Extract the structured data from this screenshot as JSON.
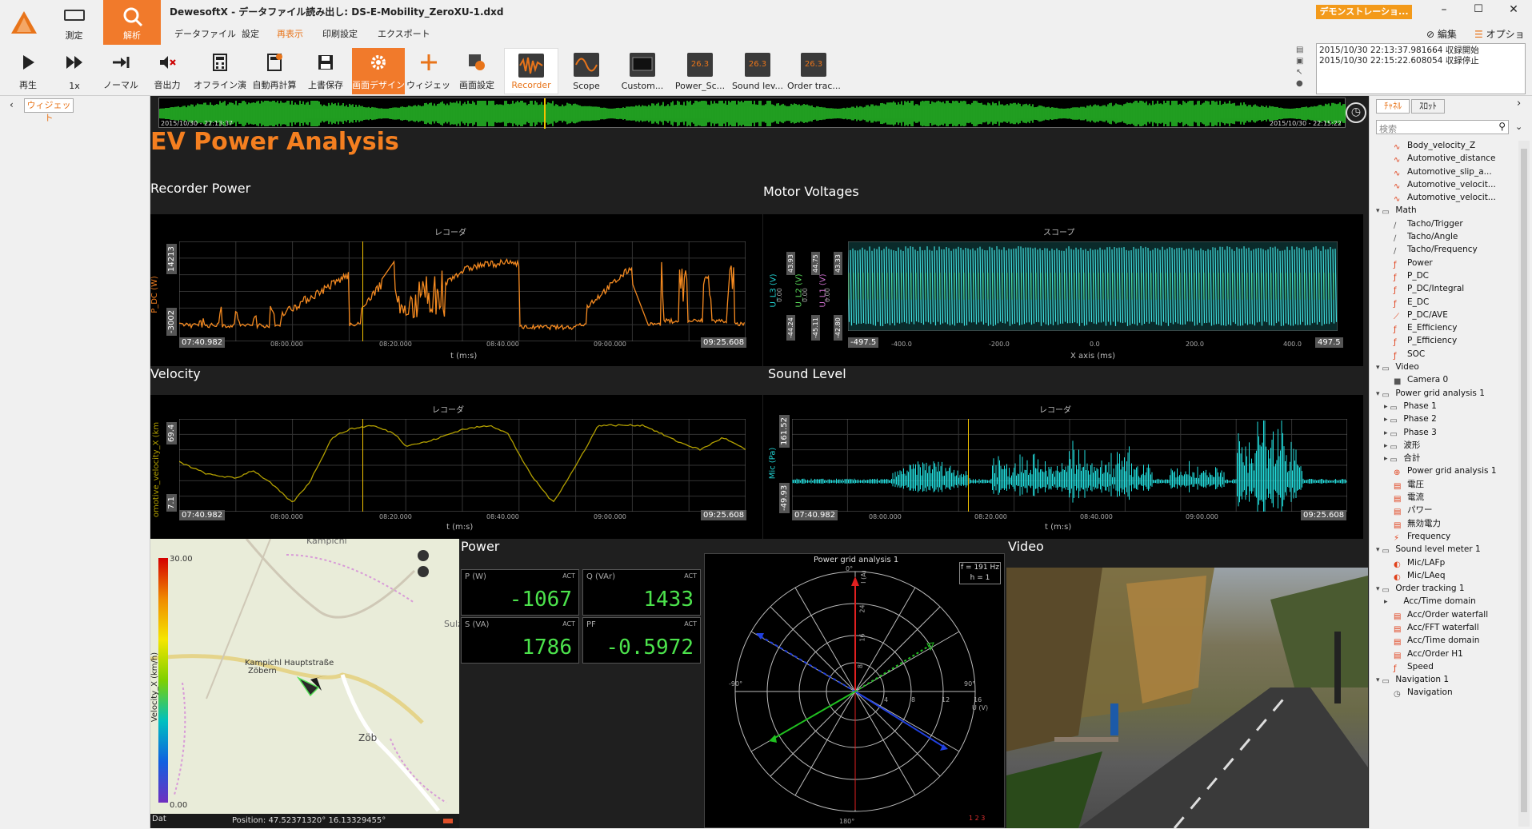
{
  "app": {
    "title": "DewesoftX - データファイル読み出し: DS-E-Mobility_ZeroXU-1.dxd",
    "demo_badge": "デモンストレーショ...",
    "edit_label": "編集",
    "options_label": "オプション"
  },
  "modes": {
    "measure": "測定",
    "analyze": "解析"
  },
  "tabs": [
    "データファイル",
    "設定",
    "再表示",
    "印刷設定",
    "エクスポート"
  ],
  "toolbar": {
    "play": "再生",
    "speed": "1x",
    "normal": "ノーマル",
    "audio": "音出力",
    "offline_calc": "オフライン演算",
    "auto_recalc": "自動再計算",
    "overwrite_save": "上書保存",
    "screen_design": "画面デザイン",
    "widget": "ウィジェット",
    "screen_settings": "画面設定",
    "instruments": [
      "Recorder",
      "Scope",
      "Custom...",
      "Power_Sc...",
      "Sound lev...",
      "Order trac..."
    ],
    "inst_badge": "26.3"
  },
  "log": [
    "2015/10/30 22:13:37.981664 収録開始",
    "2015/10/30 22:15:22.608054 収録停止"
  ],
  "left": {
    "widget_tab": "ウィジェット"
  },
  "overview": {
    "start": "2015/10/30 - 22:13:37",
    "end": "2015/10/30 - 22:15:22"
  },
  "page_title": "EV Power Analysis",
  "recorder_power": {
    "title": "Recorder Power",
    "subtitle": "レコーダ",
    "ylabel": "P_DC (W)",
    "ymax": "14213",
    "ymin": "-3002",
    "xlabel": "t (m:s)",
    "t_start": "07:40.982",
    "t_end": "09:25.608",
    "ticks": [
      "08:00.000",
      "08:20.000",
      "08:40.000",
      "09:00.000"
    ]
  },
  "motor_voltages": {
    "title": "Motor Voltages",
    "subtitle": "スコープ",
    "ylabels": [
      "U_L3 (V)",
      "U_L2 (V)",
      "U_L1 (V)"
    ],
    "axis_max": [
      "43.93",
      "44.75",
      "43.33"
    ],
    "axis_zero": [
      "0.00",
      "0.00",
      "0.00"
    ],
    "axis_min": [
      "-44.24",
      "-45.11",
      "-42.80"
    ],
    "xlabel": "X axis (ms)",
    "x_start": "-497.5",
    "x_end": "497.5",
    "ticks": [
      "-400.0",
      "-200.0",
      "0.0",
      "200.0",
      "400.0"
    ]
  },
  "velocity": {
    "title": "Velocity",
    "subtitle": "レコーダ",
    "ylabel": "omotive_velocity_X (km",
    "ymax": "69.4",
    "ymin": "7.1",
    "xlabel": "t (m:s)",
    "t_start": "07:40.982",
    "t_end": "09:25.608",
    "ticks": [
      "08:00.000",
      "08:20.000",
      "08:40.000",
      "09:00.000"
    ]
  },
  "sound_level": {
    "title": "Sound Level",
    "subtitle": "レコーダ",
    "ylabel": "Mic (Pa)",
    "ymax": "161.52",
    "ymin": "-49.93",
    "xlabel": "t (m:s)",
    "t_start": "07:40.982",
    "t_end": "09:25.608",
    "ticks": [
      "08:00.000",
      "08:20.000",
      "08:40.000",
      "09:00.000"
    ]
  },
  "map": {
    "scale_max": "30.00",
    "scale_min": "0.00",
    "scale_label": "Velocity_X (km/h)",
    "places": [
      "Kampichl",
      "Kampichl Hauptstraße",
      "Zöbern",
      "Zöb",
      "Sulzegg"
    ],
    "dat_label": "Dat",
    "position": "Position: 47.52371320° 16.13329455°"
  },
  "power": {
    "title": "Power",
    "meters": [
      {
        "name": "P (W)",
        "mode": "ACT",
        "value": "-1067"
      },
      {
        "name": "Q (VAr)",
        "mode": "ACT",
        "value": "1433"
      },
      {
        "name": "S (VA)",
        "mode": "ACT",
        "value": "1786"
      },
      {
        "name": "PF",
        "mode": "ACT",
        "value": "-0.5972"
      }
    ]
  },
  "polar": {
    "title": "Power grid analysis 1",
    "freq": "f = 191 Hz",
    "harmonic": "h = 1",
    "angles": [
      "0°",
      "90°",
      "-90°",
      "180°"
    ],
    "ring_labels": [
      "8",
      "16",
      "24"
    ],
    "u_rings": [
      "4",
      "8",
      "12",
      "16"
    ],
    "u_label": "U (V)",
    "i_label": "I (A)",
    "corner": "1 2 3"
  },
  "video": {
    "title": "Video"
  },
  "right": {
    "tabs": [
      "ﾁｬﾈﾙ",
      "ｽﾛｯﾄ"
    ],
    "search_placeholder": "検索",
    "tree": [
      {
        "label": "Body_velocity_Z",
        "level": 1,
        "icon": "wave"
      },
      {
        "label": "Automotive_distance",
        "level": 1,
        "icon": "wave"
      },
      {
        "label": "Automotive_slip_a...",
        "level": 1,
        "icon": "wave"
      },
      {
        "label": "Automotive_velocit...",
        "level": 1,
        "icon": "wave"
      },
      {
        "label": "Automotive_velocit...",
        "level": 1,
        "icon": "wave"
      },
      {
        "label": "Math",
        "level": 0,
        "icon": "folder"
      },
      {
        "label": "Tacho/Trigger",
        "level": 1,
        "icon": "slash"
      },
      {
        "label": "Tacho/Angle",
        "level": 1,
        "icon": "slash"
      },
      {
        "label": "Tacho/Frequency",
        "level": 1,
        "icon": "slash"
      },
      {
        "label": "Power",
        "level": 1,
        "icon": "f"
      },
      {
        "label": "P_DC",
        "level": 1,
        "icon": "f"
      },
      {
        "label": "P_DC/Integral",
        "level": 1,
        "icon": "f"
      },
      {
        "label": "E_DC",
        "level": 1,
        "icon": "f"
      },
      {
        "label": "P_DC/AVE",
        "level": 1,
        "icon": "chart"
      },
      {
        "label": "E_Efficiency",
        "level": 1,
        "icon": "f"
      },
      {
        "label": "P_Efficiency",
        "level": 1,
        "icon": "f"
      },
      {
        "label": "SOC",
        "level": 1,
        "icon": "f"
      },
      {
        "label": "Video",
        "level": 0,
        "icon": "folder"
      },
      {
        "label": "Camera 0",
        "level": 1,
        "icon": "camera"
      },
      {
        "label": "Power grid analysis 1",
        "level": 0,
        "icon": "folder"
      },
      {
        "label": "Phase 1",
        "level": 1,
        "icon": "subfolder"
      },
      {
        "label": "Phase 2",
        "level": 1,
        "icon": "subfolder"
      },
      {
        "label": "Phase 3",
        "level": 1,
        "icon": "subfolder"
      },
      {
        "label": "波形",
        "level": 1,
        "icon": "subfolder"
      },
      {
        "label": "合計",
        "level": 1,
        "icon": "subfolder"
      },
      {
        "label": "Power grid analysis 1",
        "level": 1,
        "icon": "grid"
      },
      {
        "label": "電圧",
        "level": 1,
        "icon": "red"
      },
      {
        "label": "電流",
        "level": 1,
        "icon": "red"
      },
      {
        "label": "パワー",
        "level": 1,
        "icon": "red"
      },
      {
        "label": "無効電力",
        "level": 1,
        "icon": "red"
      },
      {
        "label": "Frequency",
        "level": 1,
        "icon": "bolt"
      },
      {
        "label": "Sound level meter 1",
        "level": 0,
        "icon": "folder"
      },
      {
        "label": "Mic/LAFp",
        "level": 1,
        "icon": "ear"
      },
      {
        "label": "Mic/LAeq",
        "level": 1,
        "icon": "ear"
      },
      {
        "label": "Order tracking 1",
        "level": 0,
        "icon": "folder"
      },
      {
        "label": "Acc/Time domain",
        "level": 1,
        "icon": "none"
      },
      {
        "label": "Acc/Order waterfall",
        "level": 1,
        "icon": "red"
      },
      {
        "label": "Acc/FFT waterfall",
        "level": 1,
        "icon": "red"
      },
      {
        "label": "Acc/Time domain",
        "level": 1,
        "icon": "red"
      },
      {
        "label": "Acc/Order H1",
        "level": 1,
        "icon": "red"
      },
      {
        "label": "Speed",
        "level": 1,
        "icon": "f"
      },
      {
        "label": "Navigation 1",
        "level": 0,
        "icon": "folder"
      },
      {
        "label": "Navigation",
        "level": 1,
        "icon": "clock"
      }
    ]
  }
}
